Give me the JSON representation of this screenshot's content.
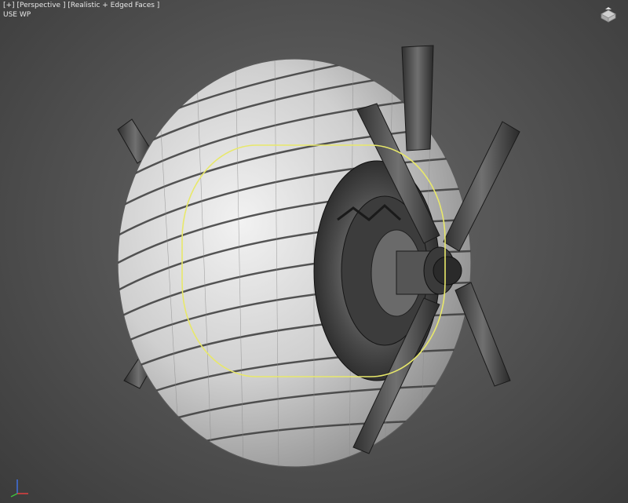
{
  "viewport": {
    "menu_plus": "[+]",
    "menu_view": "[Perspective ]",
    "menu_shading": "[Realistic + Edged Faces ]",
    "sub_label": "USE WP"
  },
  "icons": {
    "viewcube": "home-viewcube-icon",
    "axis_gizmo": "axis-tripod-icon"
  },
  "colors": {
    "background": "#555555",
    "selection_outline": "#e8e86a",
    "tire_base": "#d8d8d8",
    "axis_x": "#e04040",
    "axis_y": "#40c040",
    "axis_z": "#4070e0"
  }
}
